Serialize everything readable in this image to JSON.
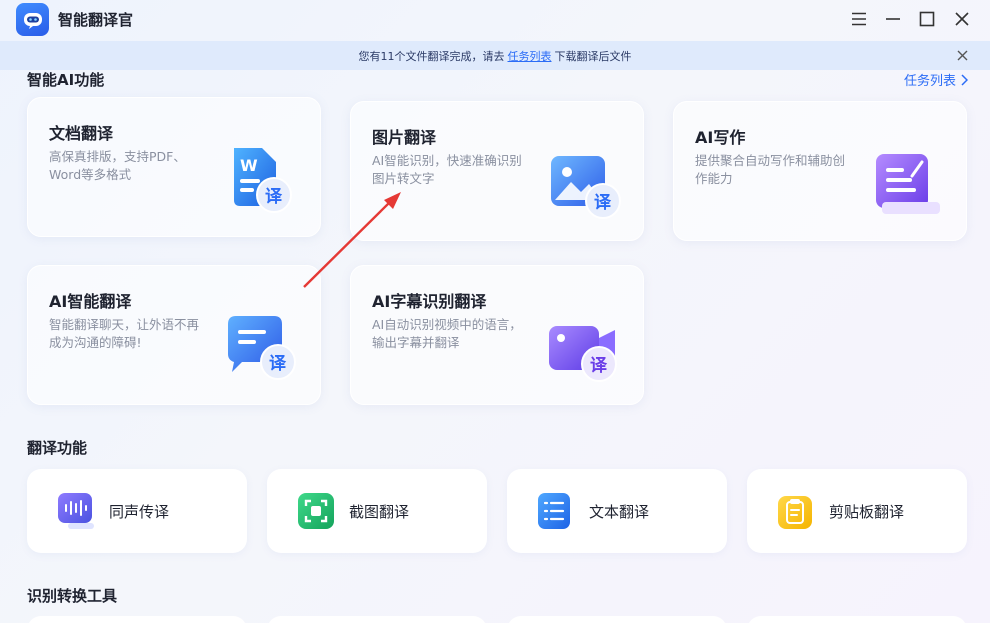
{
  "app": {
    "title": "智能翻译官"
  },
  "notice": {
    "prefix": "您有11个文件翻译完成，请去",
    "link": "任务列表",
    "suffix": "下载翻译后文件"
  },
  "ai_section": {
    "title": "智能AI功能",
    "task_list_link": "任务列表",
    "cards": [
      {
        "title": "文档翻译",
        "desc": "高保真排版，支持PDF、Word等多格式",
        "icon": "document-translate-icon"
      },
      {
        "title": "图片翻译",
        "desc": "AI智能识别，快速准确识别图片转文字",
        "icon": "image-translate-icon"
      },
      {
        "title": "AI写作",
        "desc": "提供聚合自动写作和辅助创作能力",
        "icon": "ai-writing-icon"
      },
      {
        "title": "AI智能翻译",
        "desc": "智能翻译聊天，让外语不再成为沟通的障碍!",
        "icon": "chat-translate-icon"
      },
      {
        "title": "AI字幕识别翻译",
        "desc": "AI自动识别视频中的语言，输出字幕并翻译",
        "icon": "video-subtitle-icon"
      }
    ]
  },
  "translate_section": {
    "title": "翻译功能",
    "tools": [
      {
        "label": "同声传译",
        "icon": "voice-wave-icon"
      },
      {
        "label": "截图翻译",
        "icon": "screenshot-icon"
      },
      {
        "label": "文本翻译",
        "icon": "text-list-icon"
      },
      {
        "label": "剪贴板翻译",
        "icon": "clipboard-icon"
      }
    ]
  },
  "convert_section": {
    "title": "识别转换工具"
  },
  "badge_char": "译",
  "colors": {
    "accent": "#2b6cf6",
    "notice_bg": "#dfeafc",
    "arrow": "#e53935"
  }
}
